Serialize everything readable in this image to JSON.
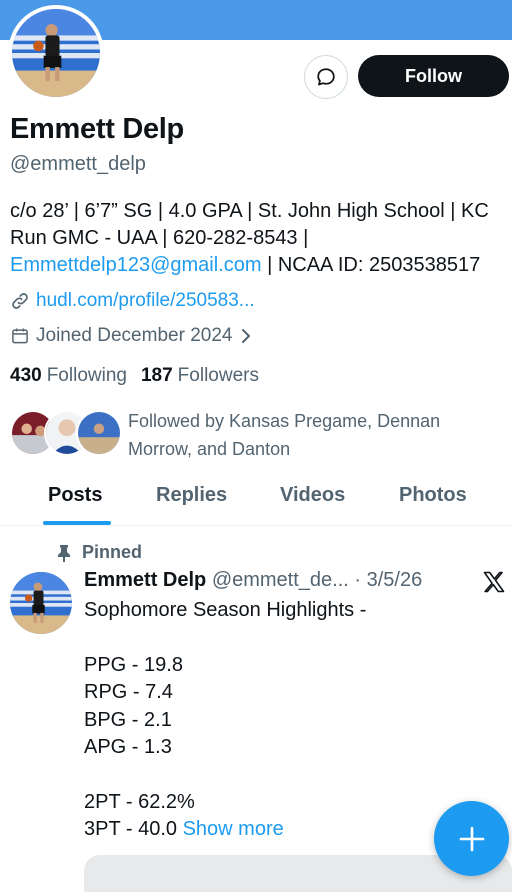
{
  "profile": {
    "name": "Emmett Delp",
    "handle": "@emmett_delp",
    "bio_text": "c/o 28’ | 6’7” SG | 4.0 GPA | St. John High School | KC Run GMC - UAA | 620-282-8543 | ",
    "bio_email": "Emmettdelp123@gmail.com",
    "bio_tail": " | NCAA ID: 2503538517",
    "website": "hudl.com/profile/250583...",
    "joined": "Joined December 2024",
    "following_count": "430",
    "following_label": "Following",
    "followers_count": "187",
    "followers_label": "Followers",
    "followed_by": "Followed by Kansas Pregame, Dennan Morrow, and Danton"
  },
  "actions": {
    "follow_label": "Follow",
    "dm_icon": "message-bubble-icon"
  },
  "tabs": [
    {
      "label": "Posts",
      "active": true
    },
    {
      "label": "Replies",
      "active": false
    },
    {
      "label": "Videos",
      "active": false
    },
    {
      "label": "Photos",
      "active": false
    }
  ],
  "pinned_post": {
    "pinned_label": "Pinned",
    "author_name": "Emmett Delp",
    "author_handle": "@emmett_de...",
    "date": "· 3/5/26",
    "lines": [
      "Sophomore Season Highlights -",
      "",
      "PPG - 19.8",
      "RPG - 7.4",
      "BPG - 2.1",
      "APG - 1.3",
      "",
      "2PT - 62.2%",
      "3PT - 40.0"
    ],
    "show_more": "Show more"
  },
  "colors": {
    "banner": "#4a99e9",
    "accent": "#1d9bf0",
    "text_primary": "#0f1419",
    "text_secondary": "#536471"
  }
}
